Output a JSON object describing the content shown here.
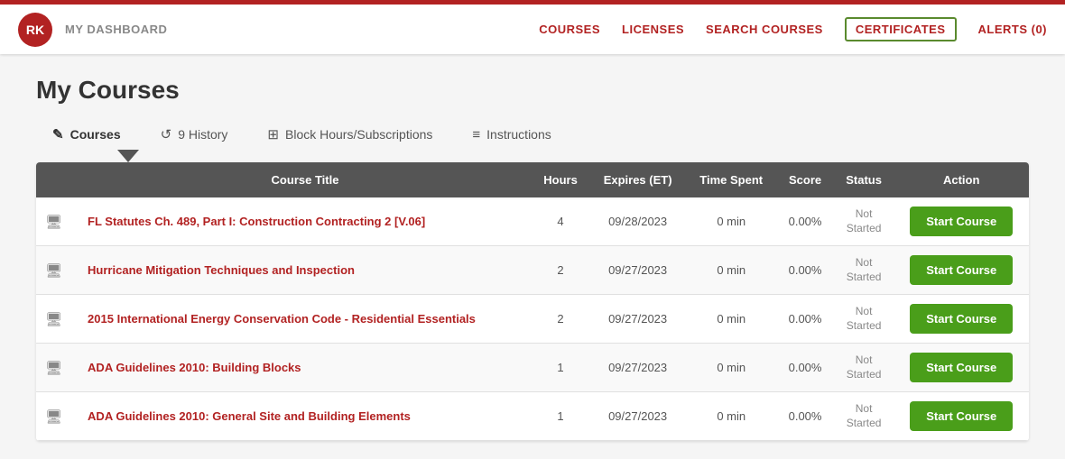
{
  "header": {
    "avatar_initials": "RK",
    "dashboard_label": "MY DASHBOARD",
    "nav_items": [
      {
        "label": "COURSES",
        "active": false
      },
      {
        "label": "LICENSES",
        "active": false
      },
      {
        "label": "SEARCH COURSES",
        "active": false
      },
      {
        "label": "CERTIFICATES",
        "active": true
      },
      {
        "label": "ALERTS (0)",
        "active": false
      }
    ]
  },
  "page": {
    "title": "My Courses"
  },
  "tabs": [
    {
      "label": "Courses",
      "active": true,
      "icon": "✎"
    },
    {
      "label": "9 History",
      "active": false,
      "icon": "↺"
    },
    {
      "label": "Block Hours/Subscriptions",
      "active": false,
      "icon": "⊞"
    },
    {
      "label": "Instructions",
      "active": false,
      "icon": "≡"
    }
  ],
  "table": {
    "columns": [
      {
        "label": ""
      },
      {
        "label": "Course Title"
      },
      {
        "label": "Hours"
      },
      {
        "label": "Expires (ET)"
      },
      {
        "label": "Time Spent"
      },
      {
        "label": "Score"
      },
      {
        "label": "Status"
      },
      {
        "label": "Action"
      }
    ],
    "rows": [
      {
        "title": "FL Statutes Ch. 489, Part I: Construction Contracting 2 [V.06]",
        "hours": "4",
        "expires": "09/28/2023",
        "time_spent": "0 min",
        "score": "0.00%",
        "status_line1": "Not",
        "status_line2": "Started",
        "action_label": "Start Course"
      },
      {
        "title": "Hurricane Mitigation Techniques and Inspection",
        "hours": "2",
        "expires": "09/27/2023",
        "time_spent": "0 min",
        "score": "0.00%",
        "status_line1": "Not",
        "status_line2": "Started",
        "action_label": "Start Course"
      },
      {
        "title": "2015 International Energy Conservation Code - Residential Essentials",
        "hours": "2",
        "expires": "09/27/2023",
        "time_spent": "0 min",
        "score": "0.00%",
        "status_line1": "Not",
        "status_line2": "Started",
        "action_label": "Start Course"
      },
      {
        "title": "ADA Guidelines 2010: Building Blocks",
        "hours": "1",
        "expires": "09/27/2023",
        "time_spent": "0 min",
        "score": "0.00%",
        "status_line1": "Not",
        "status_line2": "Started",
        "action_label": "Start Course"
      },
      {
        "title": "ADA Guidelines 2010: General Site and Building Elements",
        "hours": "1",
        "expires": "09/27/2023",
        "time_spent": "0 min",
        "score": "0.00%",
        "status_line1": "Not",
        "status_line2": "Started",
        "action_label": "Start Course"
      }
    ]
  }
}
